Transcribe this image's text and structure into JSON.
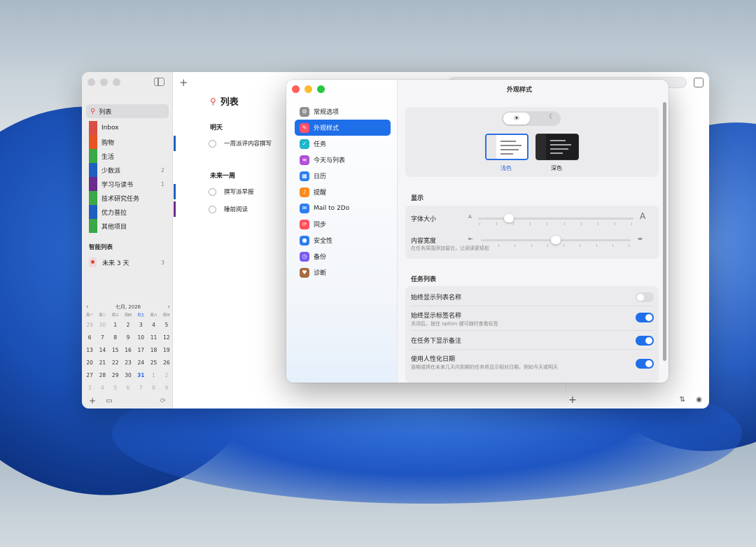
{
  "sidebar": {
    "search_label": "列表",
    "lists": [
      {
        "label": "Inbox",
        "count": "",
        "color": "#d94f43"
      },
      {
        "label": "购物",
        "count": "",
        "color": "#e8531f"
      },
      {
        "label": "生活",
        "count": "",
        "color": "#39a845"
      },
      {
        "label": "少数派",
        "count": "2",
        "color": "#1f5fbf"
      },
      {
        "label": "学习与读书",
        "count": "1",
        "color": "#6b2a8c"
      },
      {
        "label": "技术研究任务",
        "count": "",
        "color": "#39a845"
      },
      {
        "label": "优力普拉",
        "count": "",
        "color": "#1f5fbf"
      },
      {
        "label": "其他项目",
        "count": "",
        "color": "#39a845"
      }
    ],
    "smart_title": "智能列表",
    "smart_items": [
      {
        "label": "未来 3 天",
        "count": "3"
      }
    ],
    "calendar": {
      "month_label": "七月, 2026",
      "weekdays": [
        "周一",
        "周二",
        "周三",
        "周四",
        "周五",
        "周六",
        "周日"
      ],
      "days": [
        [
          "29",
          "30",
          "1",
          "2",
          "3",
          "4",
          "5"
        ],
        [
          "6",
          "7",
          "8",
          "9",
          "10",
          "11",
          "12"
        ],
        [
          "13",
          "14",
          "15",
          "16",
          "17",
          "18",
          "19"
        ],
        [
          "20",
          "21",
          "22",
          "23",
          "24",
          "25",
          "26"
        ],
        [
          "27",
          "28",
          "29",
          "30",
          "31",
          "1",
          "2"
        ],
        [
          "3",
          "4",
          "5",
          "6",
          "7",
          "8",
          "9"
        ]
      ],
      "today": "31"
    }
  },
  "main": {
    "title": "列表",
    "sections": [
      {
        "title": "明天",
        "tasks": [
          "一周派评内容撰写"
        ]
      },
      {
        "title": "未来一周",
        "tasks": [
          "撰写派早报",
          "睡前阅读"
        ]
      }
    ]
  },
  "prefs": {
    "window_title": "外观样式",
    "nav": [
      {
        "label": "常规选项",
        "icon": "gear-icon",
        "color": "#8e8e93"
      },
      {
        "label": "外观样式",
        "icon": "brush-icon",
        "color": "#ff4f6d"
      },
      {
        "label": "任务",
        "icon": "check-icon",
        "color": "#21b6c8"
      },
      {
        "label": "今天与列表",
        "icon": "list-icon",
        "color": "#b34fd8"
      },
      {
        "label": "日历",
        "icon": "calendar-icon",
        "color": "#2d7ef0"
      },
      {
        "label": "提醒",
        "icon": "bell-icon",
        "color": "#ff8a1f"
      },
      {
        "label": "Mail to 2Do",
        "icon": "mail-icon",
        "color": "#2d7ef0"
      },
      {
        "label": "同步",
        "icon": "sync-icon",
        "color": "#ff4d5a"
      },
      {
        "label": "安全性",
        "icon": "lock-icon",
        "color": "#2d7ef0"
      },
      {
        "label": "备份",
        "icon": "clock-icon",
        "color": "#7a5af0"
      },
      {
        "label": "诊断",
        "icon": "stethoscope-icon",
        "color": "#a86a3e"
      }
    ],
    "appearance": {
      "light": "浅色",
      "dark": "深色",
      "selected": "light"
    },
    "display": {
      "section": "显示",
      "font_size": {
        "label": "字体大小",
        "small_cap": "A",
        "large_cap": "A",
        "value": 0.2
      },
      "content_width": {
        "label": "内容宽度",
        "sub": "在任务周围添加留白，让阅读更轻松",
        "value": 0.5
      }
    },
    "tasklist": {
      "section": "任务列表",
      "rows": [
        {
          "label": "始终显示列表名称",
          "sub": "",
          "on": false
        },
        {
          "label": "始终显示标签名称",
          "sub": "关闭后，按住 option 键可随时查看标签",
          "on": true
        },
        {
          "label": "在任务下显示备注",
          "sub": "",
          "on": true
        },
        {
          "label": "使用人性化日期",
          "sub": "逾期或将在未来几天内到期的任务将显示相对日期，例如今天或明天",
          "on": true
        }
      ]
    }
  }
}
